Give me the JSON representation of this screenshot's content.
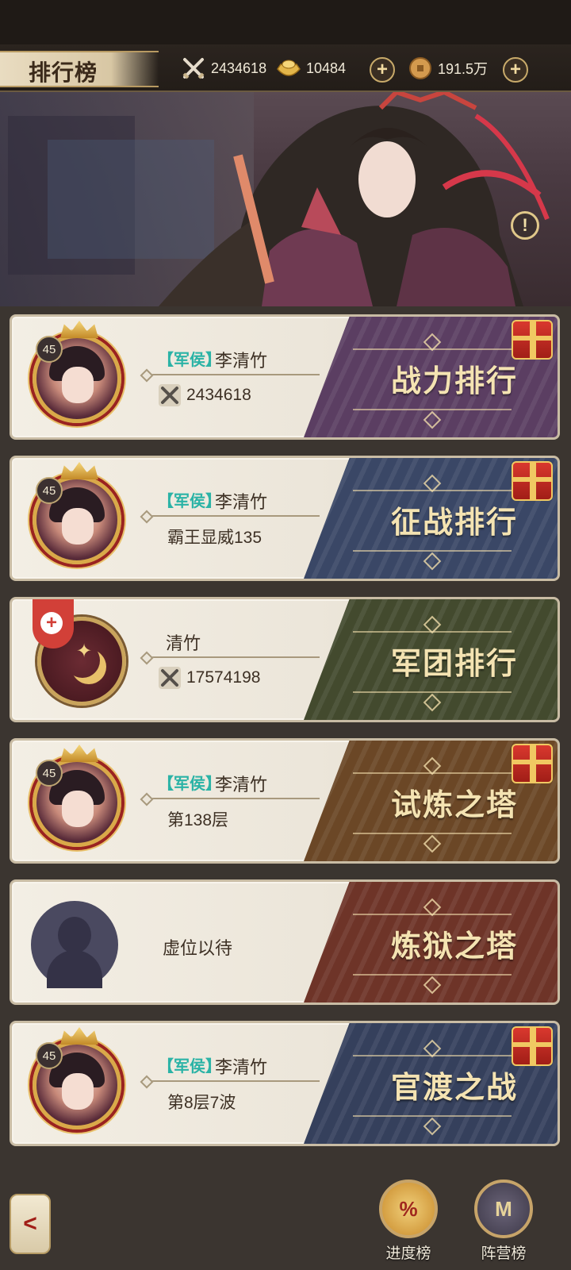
{
  "header": {
    "title": "排行榜",
    "power_icon": "crossed-swords-icon",
    "power": "2434618",
    "ingot_icon": "gold-ingot-icon",
    "ingots": "10484",
    "coin_icon": "copper-coin-icon",
    "coins": "191.5万",
    "add_symbol": "+"
  },
  "banner": {
    "info_symbol": "!"
  },
  "cards": [
    {
      "title": "战力排行",
      "level": "45",
      "tag": "【军侯】",
      "name": "李清竹",
      "stat": "2434618",
      "gift": true,
      "color": "#5b3e62"
    },
    {
      "title": "征战排行",
      "level": "45",
      "tag": "【军侯】",
      "name": "李清竹",
      "stat": "霸王显威135",
      "gift": true,
      "color": "#3a4766"
    },
    {
      "title": "军团排行",
      "name": "清竹",
      "stat": "17574198",
      "add_symbol": "+",
      "gift": false,
      "color": "#434a2e"
    },
    {
      "title": "试炼之塔",
      "level": "45",
      "tag": "【军侯】",
      "name": "李清竹",
      "stat": "第138层",
      "gift": true,
      "color": "#6b4726"
    },
    {
      "title": "炼狱之塔",
      "vacant": "虚位以待",
      "gift": false,
      "color": "#6e3428"
    },
    {
      "title": "官渡之战",
      "level": "45",
      "tag": "【军侯】",
      "name": "李清竹",
      "stat": "第8层7波",
      "gift": true,
      "color": "#35405c"
    }
  ],
  "bottom_nav": {
    "back_symbol": "<",
    "progress_label": "进度榜",
    "progress_symbol": "%",
    "camp_label": "阵营榜",
    "camp_symbol": "M"
  },
  "colors": {
    "accent_gold": "#d9a949",
    "tag_teal": "#2bb3a6",
    "gift_red": "#d9382e"
  }
}
